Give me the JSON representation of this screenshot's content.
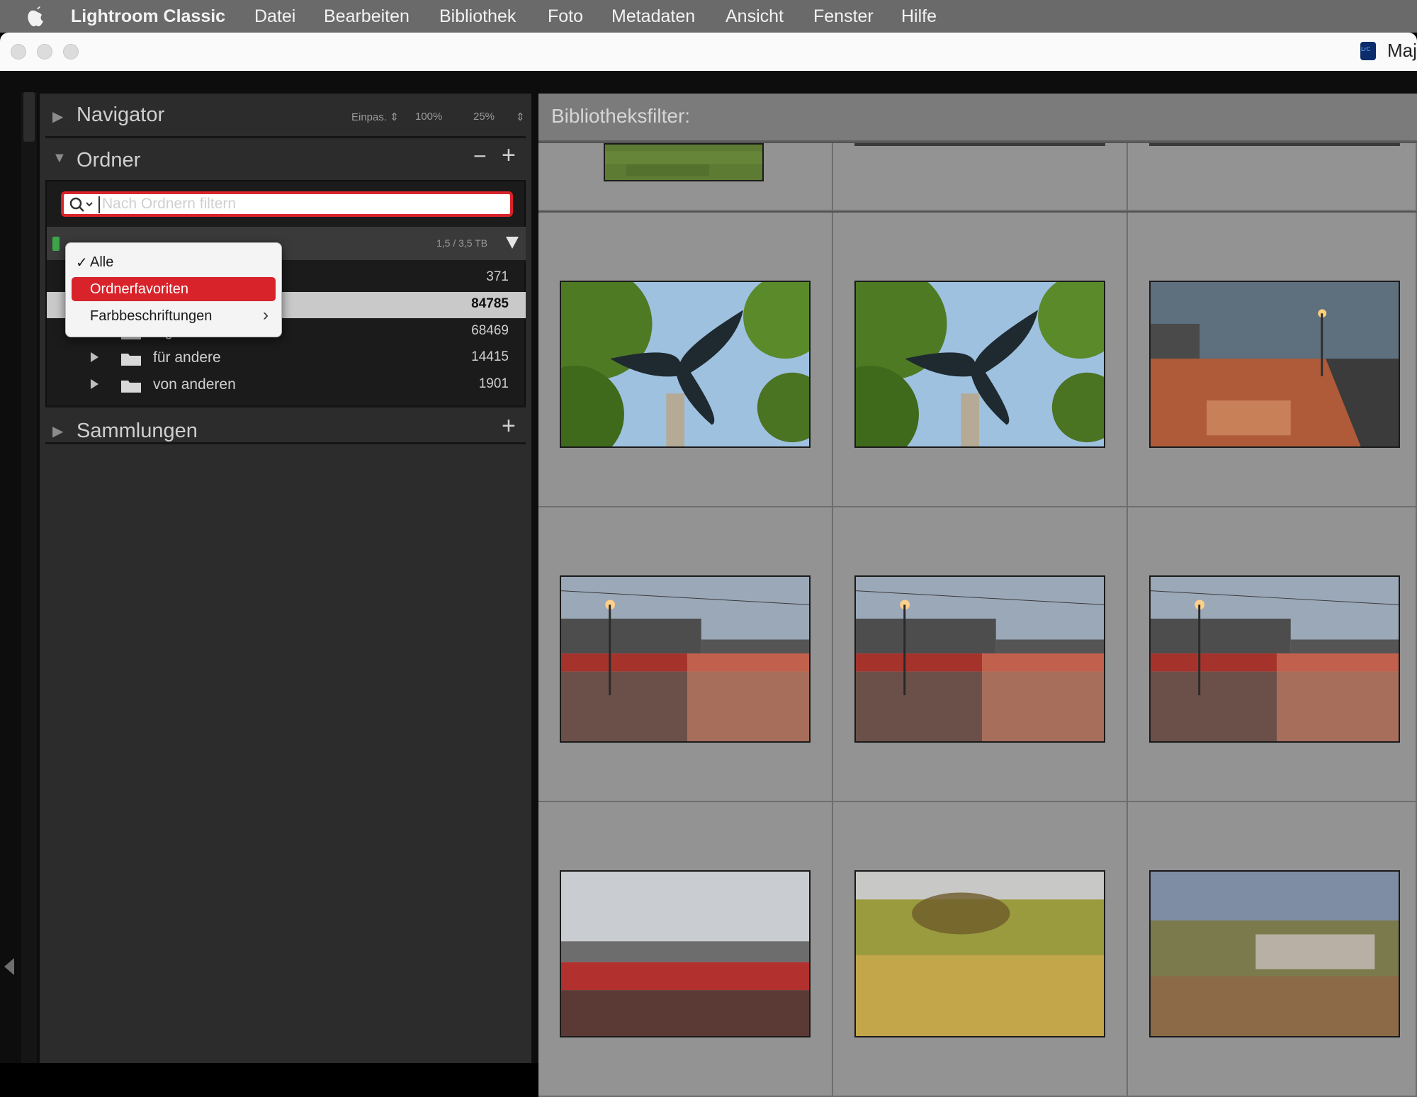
{
  "menubar": {
    "apple_icon": "apple-logo-icon",
    "app_name": "Lightroom Classic",
    "items": [
      "Datei",
      "Bearbeiten",
      "Bibliothek",
      "Foto",
      "Metadaten",
      "Ansicht",
      "Fenster",
      "Hilfe"
    ]
  },
  "window": {
    "title": "Maj",
    "app_icon": "lightroom-classic-icon"
  },
  "navigator": {
    "title": "Navigator",
    "options": [
      "Einpas. ⇕",
      "100%",
      "25%",
      "⇕"
    ]
  },
  "folders": {
    "title": "Ordner",
    "minus": "−",
    "plus": "+",
    "search_placeholder": "Nach Ordnern filtern",
    "volume_capacity": "1,5 / 3,5 TB",
    "rows": [
      {
        "label": "",
        "count": "371"
      },
      {
        "label": "",
        "count": "84785"
      },
      {
        "label": "eigene",
        "count": "68469"
      },
      {
        "label": "für andere",
        "count": "14415"
      },
      {
        "label": "von anderen",
        "count": "1901"
      }
    ]
  },
  "dropdown": {
    "items": [
      {
        "label": "Alle",
        "checked": true
      },
      {
        "label": "Ordnerfavoriten",
        "selected": true
      },
      {
        "label": "Farbbeschriftungen",
        "submenu": true
      }
    ]
  },
  "collections": {
    "title": "Sammlungen",
    "plus": "+"
  },
  "library_filter": {
    "label": "Bibliotheksfilter:"
  },
  "grid": {
    "thumbnails": [
      {
        "subject": "grass"
      },
      {
        "subject": "dragonfly-sculpture"
      },
      {
        "subject": "dragonfly-sculpture"
      },
      {
        "subject": "train-window-reflection"
      },
      {
        "subject": "station-platform"
      },
      {
        "subject": "station-platform"
      },
      {
        "subject": "station-platform"
      },
      {
        "subject": "blurred-red-train"
      },
      {
        "subject": "blurred-field"
      },
      {
        "subject": "blurred-landscape"
      }
    ]
  },
  "colors": {
    "accent_red": "#d8232a",
    "menubar_bg": "#6a6a6a",
    "panel_bg": "#2c2c2c",
    "grid_cell": "#939393"
  }
}
